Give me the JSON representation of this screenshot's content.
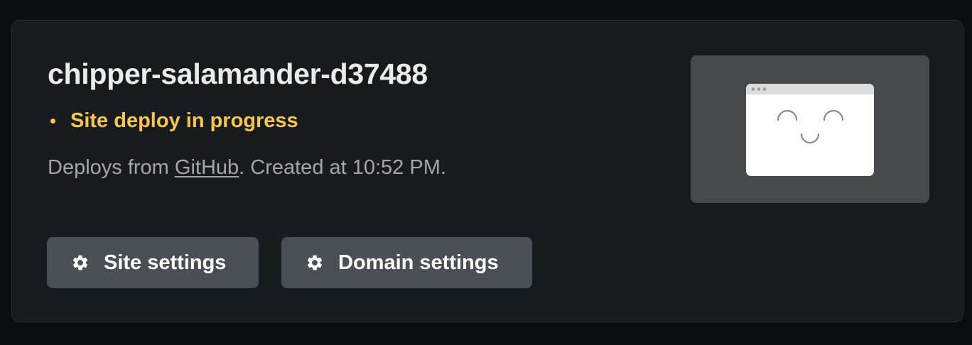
{
  "site": {
    "name": "chipper-salamander-d37488",
    "status": "Site deploy in progress",
    "status_color": "#f9c74f",
    "meta_prefix": "Deploys from ",
    "meta_link": "GitHub",
    "meta_suffix": ". Created at 10:52 PM."
  },
  "actions": {
    "site_settings_label": "Site settings",
    "domain_settings_label": "Domain settings",
    "icon": "gear-icon"
  },
  "preview": {
    "illustration": "smiling-browser-window-icon"
  }
}
